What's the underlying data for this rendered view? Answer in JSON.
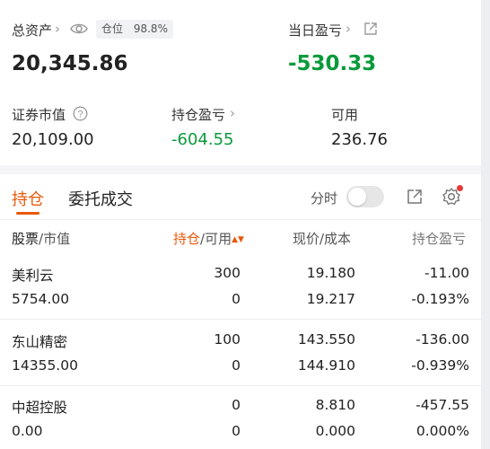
{
  "summary": {
    "total_assets_label": "总资产",
    "position_label": "仓位",
    "position_value": "98.8%",
    "total_assets_value": "20,345.86",
    "daily_pnl_label": "当日盈亏",
    "daily_pnl_value": "-530.33",
    "market_value_label": "证券市值",
    "market_value_value": "20,109.00",
    "holding_pnl_label": "持仓盈亏",
    "holding_pnl_value": "-604.55",
    "available_label": "可用",
    "available_value": "236.76"
  },
  "tabs": [
    {
      "label": "持仓",
      "active": true
    },
    {
      "label": "委托成交",
      "active": false
    }
  ],
  "timeshare_label": "分时",
  "table": {
    "headers": {
      "stock": "股票",
      "market_value": "/市值",
      "holding": "持仓",
      "available": "/可用",
      "price": "现价/成本",
      "pnl": "持仓盈亏"
    },
    "rows": [
      {
        "name": "美利云",
        "market_value": "5754.00",
        "holding": "300",
        "available": "0",
        "price": "19.180",
        "cost": "19.217",
        "pnl": "-11.00",
        "pnl_pct": "-0.193%"
      },
      {
        "name": "东山精密",
        "market_value": "14355.00",
        "holding": "100",
        "available": "0",
        "price": "143.550",
        "cost": "144.910",
        "pnl": "-136.00",
        "pnl_pct": "-0.939%"
      },
      {
        "name": "中超控股",
        "market_value": "0.00",
        "holding": "0",
        "available": "0",
        "price": "8.810",
        "cost": "0.000",
        "pnl": "-457.55",
        "pnl_pct": "0.000%"
      }
    ]
  },
  "colors": {
    "loss": "#0a9a3c",
    "accent": "#e8590c"
  },
  "icons": [
    "chevron-right-icon",
    "eye-icon",
    "external-link-icon",
    "help-circle-icon",
    "share-icon",
    "settings-gear-icon",
    "sort-icon"
  ]
}
